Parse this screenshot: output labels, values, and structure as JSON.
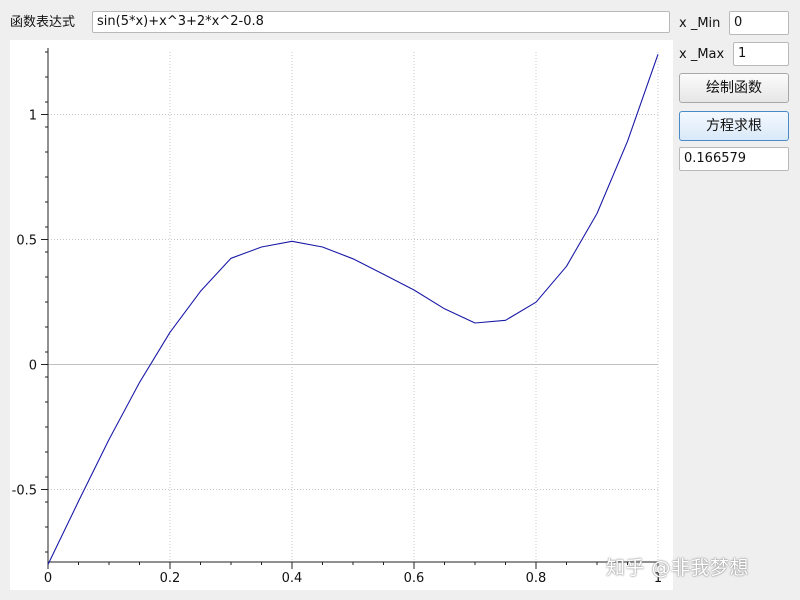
{
  "form": {
    "expression_label": "函数表达式",
    "expression_value": "sin(5*x)+x^3+2*x^2-0.8",
    "x_min_label": "x _Min",
    "x_min_value": "0",
    "x_max_label": "x _Max",
    "x_max_value": "1",
    "plot_button": "绘制函数",
    "solve_button": "方程求根",
    "root_value": "0.166579"
  },
  "chart_data": {
    "type": "line",
    "function": "sin(5*x)+x^3+2*x^2-0.8",
    "xlim": [
      0,
      1
    ],
    "ylim": [
      -0.79,
      1.25
    ],
    "x_ticks": [
      0,
      0.2,
      0.4,
      0.6,
      0.8,
      1
    ],
    "x_tick_labels": [
      "0",
      "0.2",
      "0.4",
      "0.6",
      "0.8",
      "1"
    ],
    "y_ticks": [
      -0.5,
      0,
      0.5,
      1
    ],
    "y_tick_labels": [
      "-0.5",
      "0",
      "0.5",
      "1"
    ],
    "grid": true,
    "series": [
      {
        "color": "#1a1aa8",
        "x": [
          0,
          0.05,
          0.1,
          0.15,
          0.2,
          0.25,
          0.3,
          0.35,
          0.4,
          0.45,
          0.5,
          0.55,
          0.6,
          0.65,
          0.7,
          0.75,
          0.8,
          0.85,
          0.9,
          0.95,
          1
        ],
        "y": [
          -0.8,
          -0.547,
          -0.3,
          -0.072,
          0.129,
          0.293,
          0.425,
          0.47,
          0.493,
          0.47,
          0.423,
          0.361,
          0.298,
          0.223,
          0.166,
          0.177,
          0.249,
          0.393,
          0.604,
          0.893,
          1.241
        ]
      }
    ]
  },
  "watermark": "知乎 @非我梦想",
  "colors": {
    "curve": "#1a1aa8",
    "grid": "#c8c8c8",
    "zero_line": "#c0c0c0",
    "plot_bg": "#ffffff",
    "window_bg": "#efefef"
  }
}
